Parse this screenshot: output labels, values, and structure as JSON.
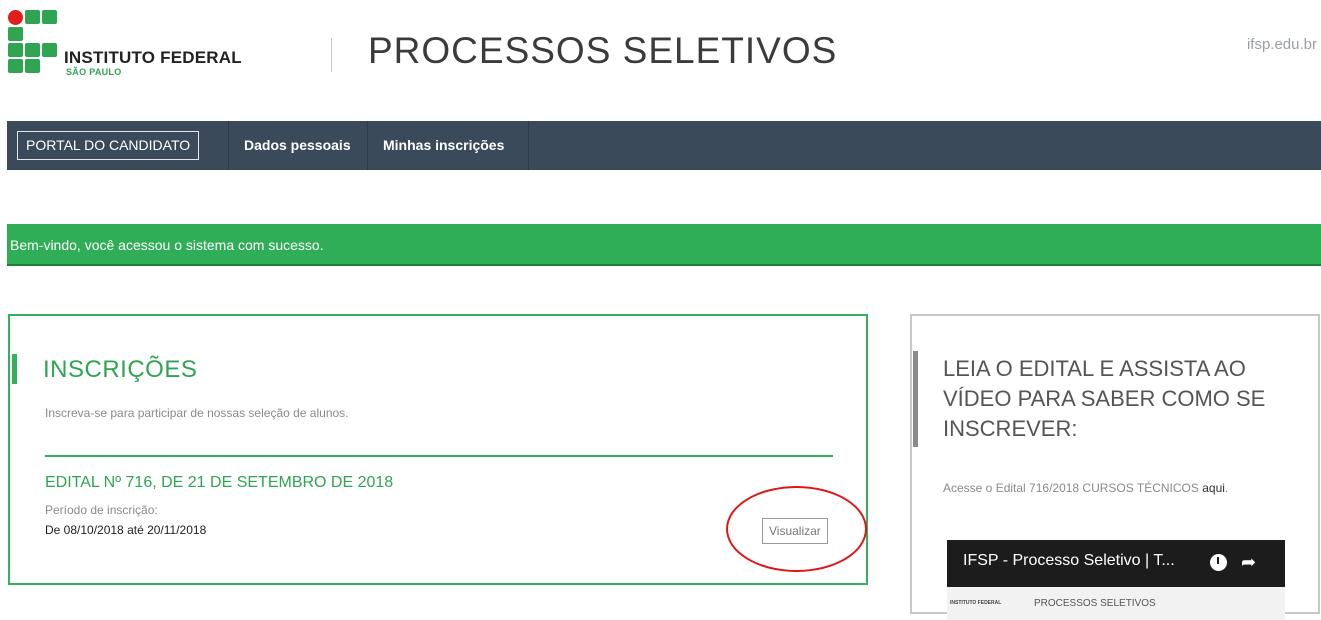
{
  "header": {
    "logo_title": "INSTITUTO FEDERAL",
    "logo_subtitle": "SÃO PAULO",
    "page_title": "PROCESSOS SELETIVOS",
    "site_link": "ifsp.edu.br"
  },
  "nav": {
    "portal_label": "PORTAL DO CANDIDATO",
    "items": [
      {
        "label": "Dados pessoais"
      },
      {
        "label": "Minhas inscrições"
      }
    ]
  },
  "alert": {
    "message": "Bem-vindo, você acessou o sistema com sucesso."
  },
  "inscricoes": {
    "title": "INSCRIÇÕES",
    "lead": "Inscreva-se para participar de nossas seleção de alunos.",
    "edital": {
      "title": "EDITAL Nº 716, DE 21 DE SETEMBRO DE 2018",
      "periodo_label": "Período de inscrição:",
      "periodo": "De 08/10/2018 até 20/11/2018",
      "button_label": "Visualizar"
    }
  },
  "side": {
    "title": "LEIA O EDITAL E ASSISTA AO VÍDEO PARA SABER COMO SE INSCREVER:",
    "note_prefix": "Acesse o Edital 716/2018 CURSOS TÉCNICOS ",
    "note_link": "aqui",
    "note_suffix": ".",
    "video": {
      "title": "IFSP - Processo Seletivo | T...",
      "thumb_left": "INSTITUTO FEDERAL",
      "thumb_title": "PROCESSOS SELETIVOS"
    }
  },
  "colors": {
    "brand_green": "#2fa552",
    "brand_red": "#e31d1a",
    "nav_bg": "#3b4a5b",
    "alert_bg": "#2fae57",
    "annotation_red": "#e01515"
  }
}
